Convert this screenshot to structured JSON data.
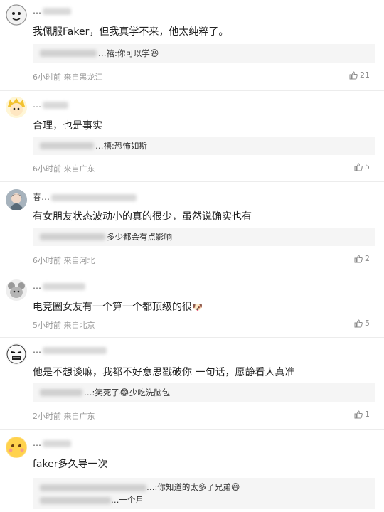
{
  "comments": [
    {
      "username": "…",
      "avatar_icon": "cartoon-face-icon",
      "text": "我佩服Faker，但我真学不来，他太纯粹了。",
      "reply_text": "…禧:你可以学",
      "reply_emoji": "😆",
      "meta": "6小时前 来自黑龙江",
      "likes": "21"
    },
    {
      "username": "…",
      "avatar_icon": "yellow-hair-avatar-icon",
      "text": "合理，也是事实",
      "reply_text": "…禧:恐怖如斯",
      "meta": "6小时前 来自广东",
      "likes": "5"
    },
    {
      "username": "春…",
      "avatar_icon": "anime-avatar-icon",
      "text": "有女朋友状态波动小的真的很少，虽然说确实也有",
      "reply_text": "多少都会有点影响",
      "meta": "6小时前 来自河北",
      "likes": "2"
    },
    {
      "username": "…",
      "avatar_icon": "mouse-avatar-icon",
      "text": "电竞圈女友有一个算一个都顶级的很",
      "text_emoji": "🐶",
      "meta": "5小时前 来自北京",
      "likes": "5"
    },
    {
      "username": "…",
      "avatar_icon": "meme-face-avatar-icon",
      "text": "他是不想谈嘛，我都不好意思戳破你 一句话，愿静看人真准",
      "reply_text": "…:笑死了",
      "reply_emoji": "😂",
      "reply_text_after": "少吃洗脑包",
      "meta": "2小时前 来自广东",
      "likes": "1"
    },
    {
      "username": "…",
      "avatar_icon": "emoji-face-avatar-icon",
      "text": "faker多久导一次",
      "reply_line1": "…:你知道的太多了兄弟",
      "reply_line1_emoji": "😆",
      "reply_line2": "…一个月"
    }
  ],
  "colors": {
    "background": "#ffffff",
    "reply_background": "#f5f5f5",
    "meta_text": "#9a9a9a",
    "divider": "#ececec"
  }
}
